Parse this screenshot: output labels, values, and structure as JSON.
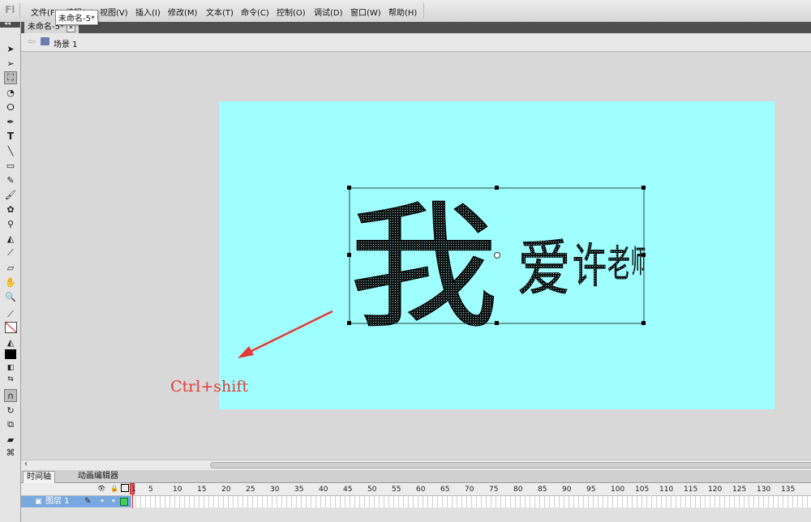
{
  "app": {
    "logo": "Fl"
  },
  "menu": [
    "文件(F)",
    "编辑(E)",
    "视图(V)",
    "插入(I)",
    "修改(M)",
    "文本(T)",
    "命令(C)",
    "控制(O)",
    "调试(D)",
    "窗口(W)",
    "帮助(H)"
  ],
  "tooltip": "未命名-5*",
  "document_tab": {
    "title": "未命名-5*"
  },
  "scene": {
    "label": "场景 1"
  },
  "stage": {
    "background": "#9ffefe",
    "text_main": "我",
    "text_rest": [
      "爱",
      "许",
      "老",
      "师"
    ]
  },
  "annotation": {
    "text": "Ctrl+shift",
    "color": "#e53935"
  },
  "timeline": {
    "tabs": [
      "时间轴",
      "动画编辑器"
    ],
    "layer_name": "图层 1",
    "frame_numbers": [
      "1",
      "5",
      "10",
      "15",
      "20",
      "25",
      "30",
      "35",
      "40",
      "45",
      "50",
      "55",
      "60",
      "65",
      "70",
      "75",
      "80",
      "85",
      "90",
      "95",
      "100",
      "105",
      "110",
      "115",
      "120",
      "125",
      "130",
      "135"
    ]
  }
}
